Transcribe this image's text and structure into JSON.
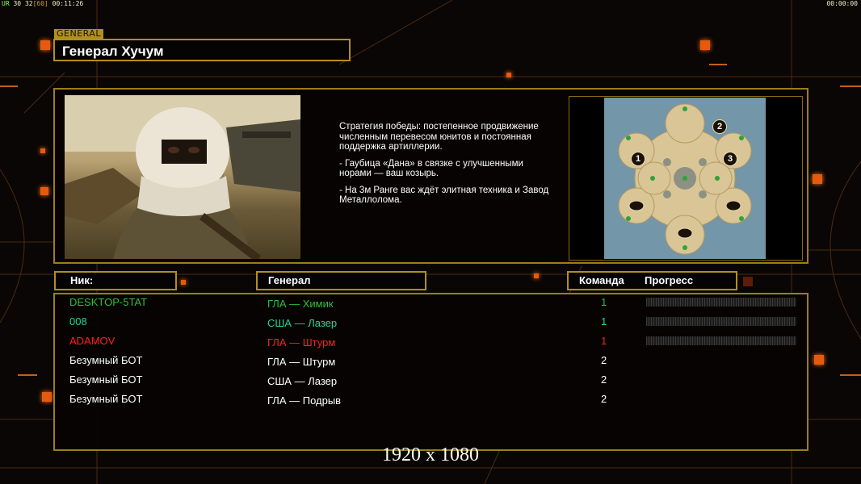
{
  "hud": {
    "stats_prefix": "UR",
    "stats_a": "30",
    "stats_b": "32",
    "stats_c": "[60]",
    "elapsed": "00:11:26",
    "clock": "00:00:00"
  },
  "section_tag": "GENERAL",
  "general_title": "Генерал Хучум",
  "description": [
    "Стратегия победы: постепенное продвижение численным перевесом юнитов и постоянная поддержка артиллерии.",
    "- Гаубица «Дана» в связке с улучшенными норами — ваш козырь.",
    "- На 3м Ранге вас ждёт элитная техника и Завод Металлолома."
  ],
  "map": {
    "start_positions": [
      "1",
      "2",
      "3"
    ]
  },
  "table": {
    "headers": {
      "nick": "Ник:",
      "general": "Генерал",
      "team": "Команда",
      "progress": "Прогресс"
    },
    "rows": [
      {
        "nick": "DESKTOP-5TAT",
        "general": "ГЛА — Химик",
        "team": "1",
        "color": "#2fbf3a",
        "has_progress": true
      },
      {
        "nick": "008",
        "general": "США — Лазер",
        "team": "1",
        "color": "#27d39a",
        "has_progress": true
      },
      {
        "nick": "ADAMOV",
        "general": "ГЛА — Штурм",
        "team": "1",
        "color": "#ff2020",
        "has_progress": true
      },
      {
        "nick": "Безумный БОТ",
        "general": "ГЛА — Штурм",
        "team": "2",
        "color": "#ffffff",
        "has_progress": false
      },
      {
        "nick": "Безумный БОТ",
        "general": "США — Лазер",
        "team": "2",
        "color": "#ffffff",
        "has_progress": false
      },
      {
        "nick": "Безумный БОТ",
        "general": "ГЛА — Подрыв",
        "team": "2",
        "color": "#ffffff",
        "has_progress": false
      }
    ]
  },
  "resolution_label": "1920 x 1080",
  "colors": {
    "accent_gold": "#b48f1a",
    "accent_orange": "#e8590f"
  }
}
